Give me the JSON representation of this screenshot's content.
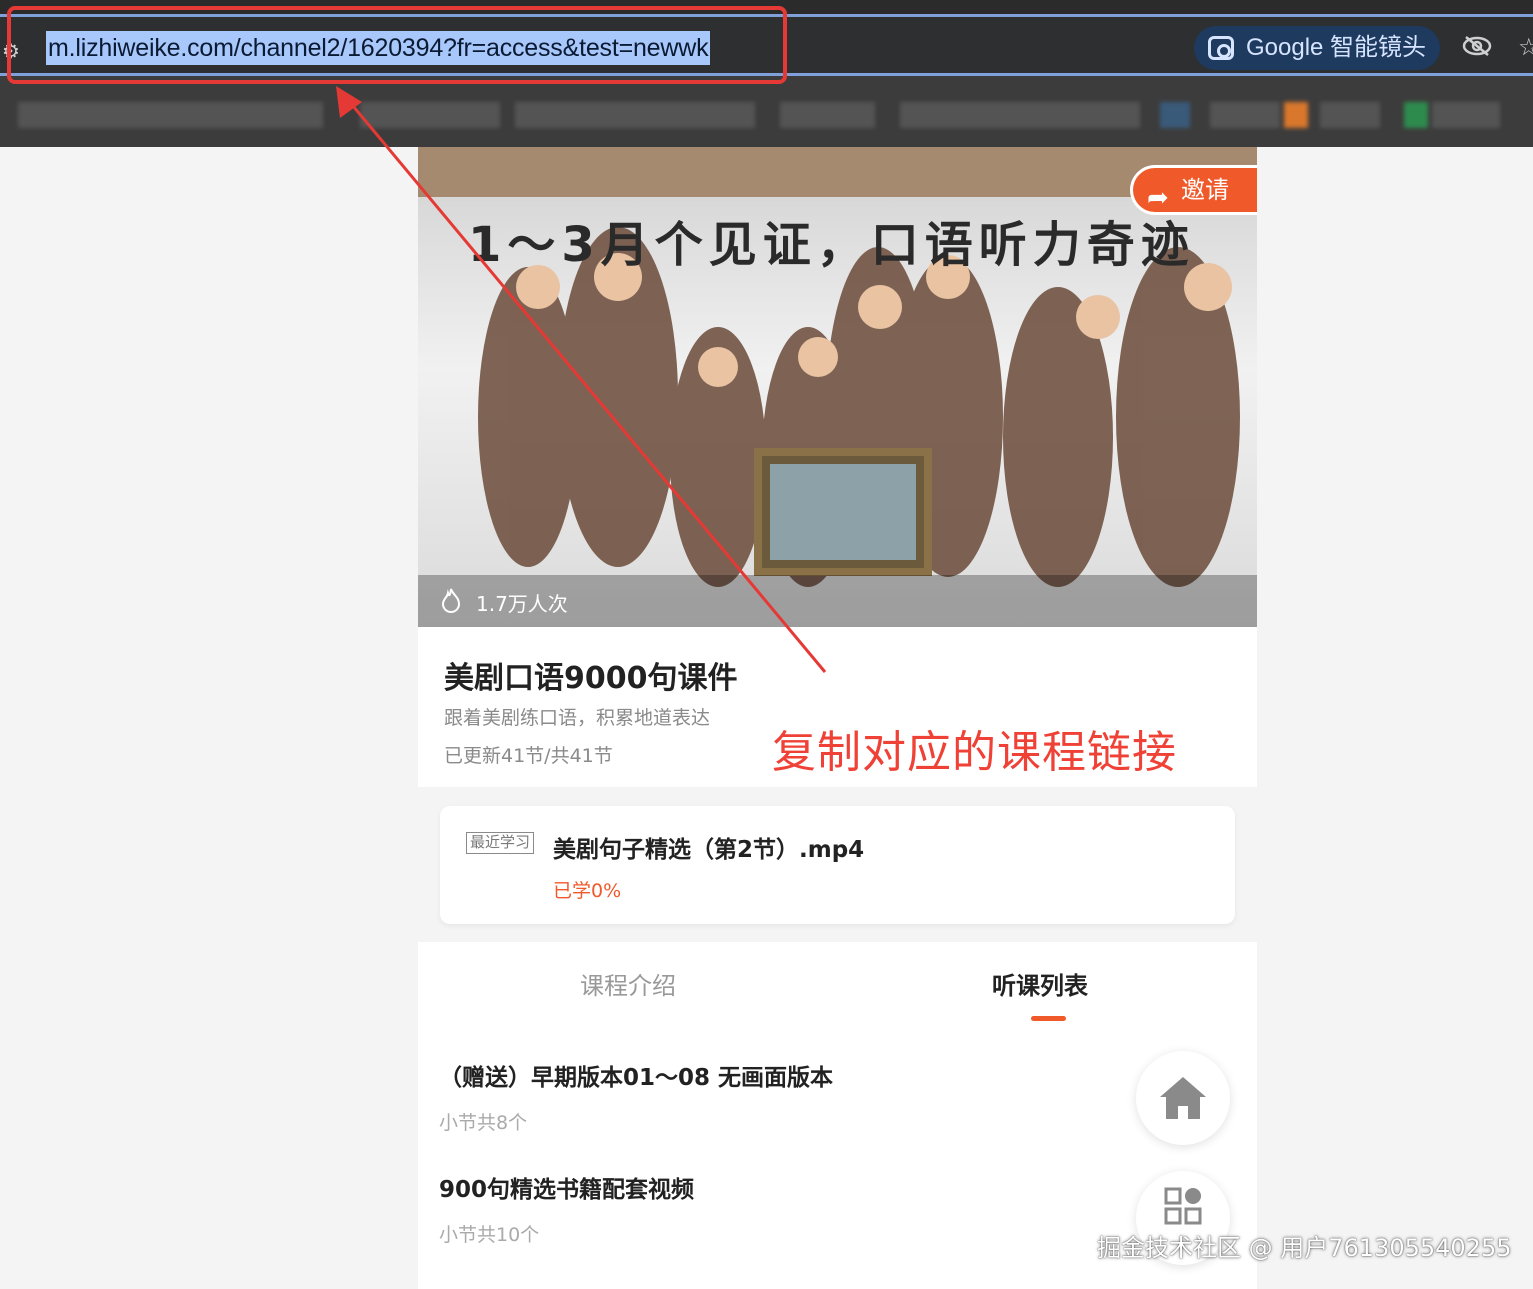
{
  "browser": {
    "url": "m.lizhiweike.com/channel2/1620394?fr=access&test=newwk",
    "lens_label": "Google 智能镜头"
  },
  "banner": {
    "headline": "1～3月个见证，口语听力奇迹",
    "invite_label": "邀请",
    "views": "1.7万人次"
  },
  "course": {
    "title": "美剧口语9000句课件",
    "subtitle": "跟着美剧练口语，积累地道表达",
    "progress": "已更新41节/共41节"
  },
  "recent": {
    "tag": "最近学习",
    "title": "美剧句子精选（第2节）.mp4",
    "learned": "已学0%"
  },
  "tabs": [
    {
      "label": "课程介绍",
      "active": false
    },
    {
      "label": "听课列表",
      "active": true
    }
  ],
  "list": [
    {
      "title": "（赠送）早期版本01～08 无画面版本",
      "count": "小节共8个"
    },
    {
      "title": "900句精选书籍配套视频",
      "count": "小节共10个"
    }
  ],
  "annotation": "复制对应的课程链接",
  "watermark": "掘金技术社区 @ 用户761305540255",
  "colors": {
    "accent": "#f0592a",
    "annotation": "#ef4136",
    "url_highlight": "#a8c7fa"
  }
}
